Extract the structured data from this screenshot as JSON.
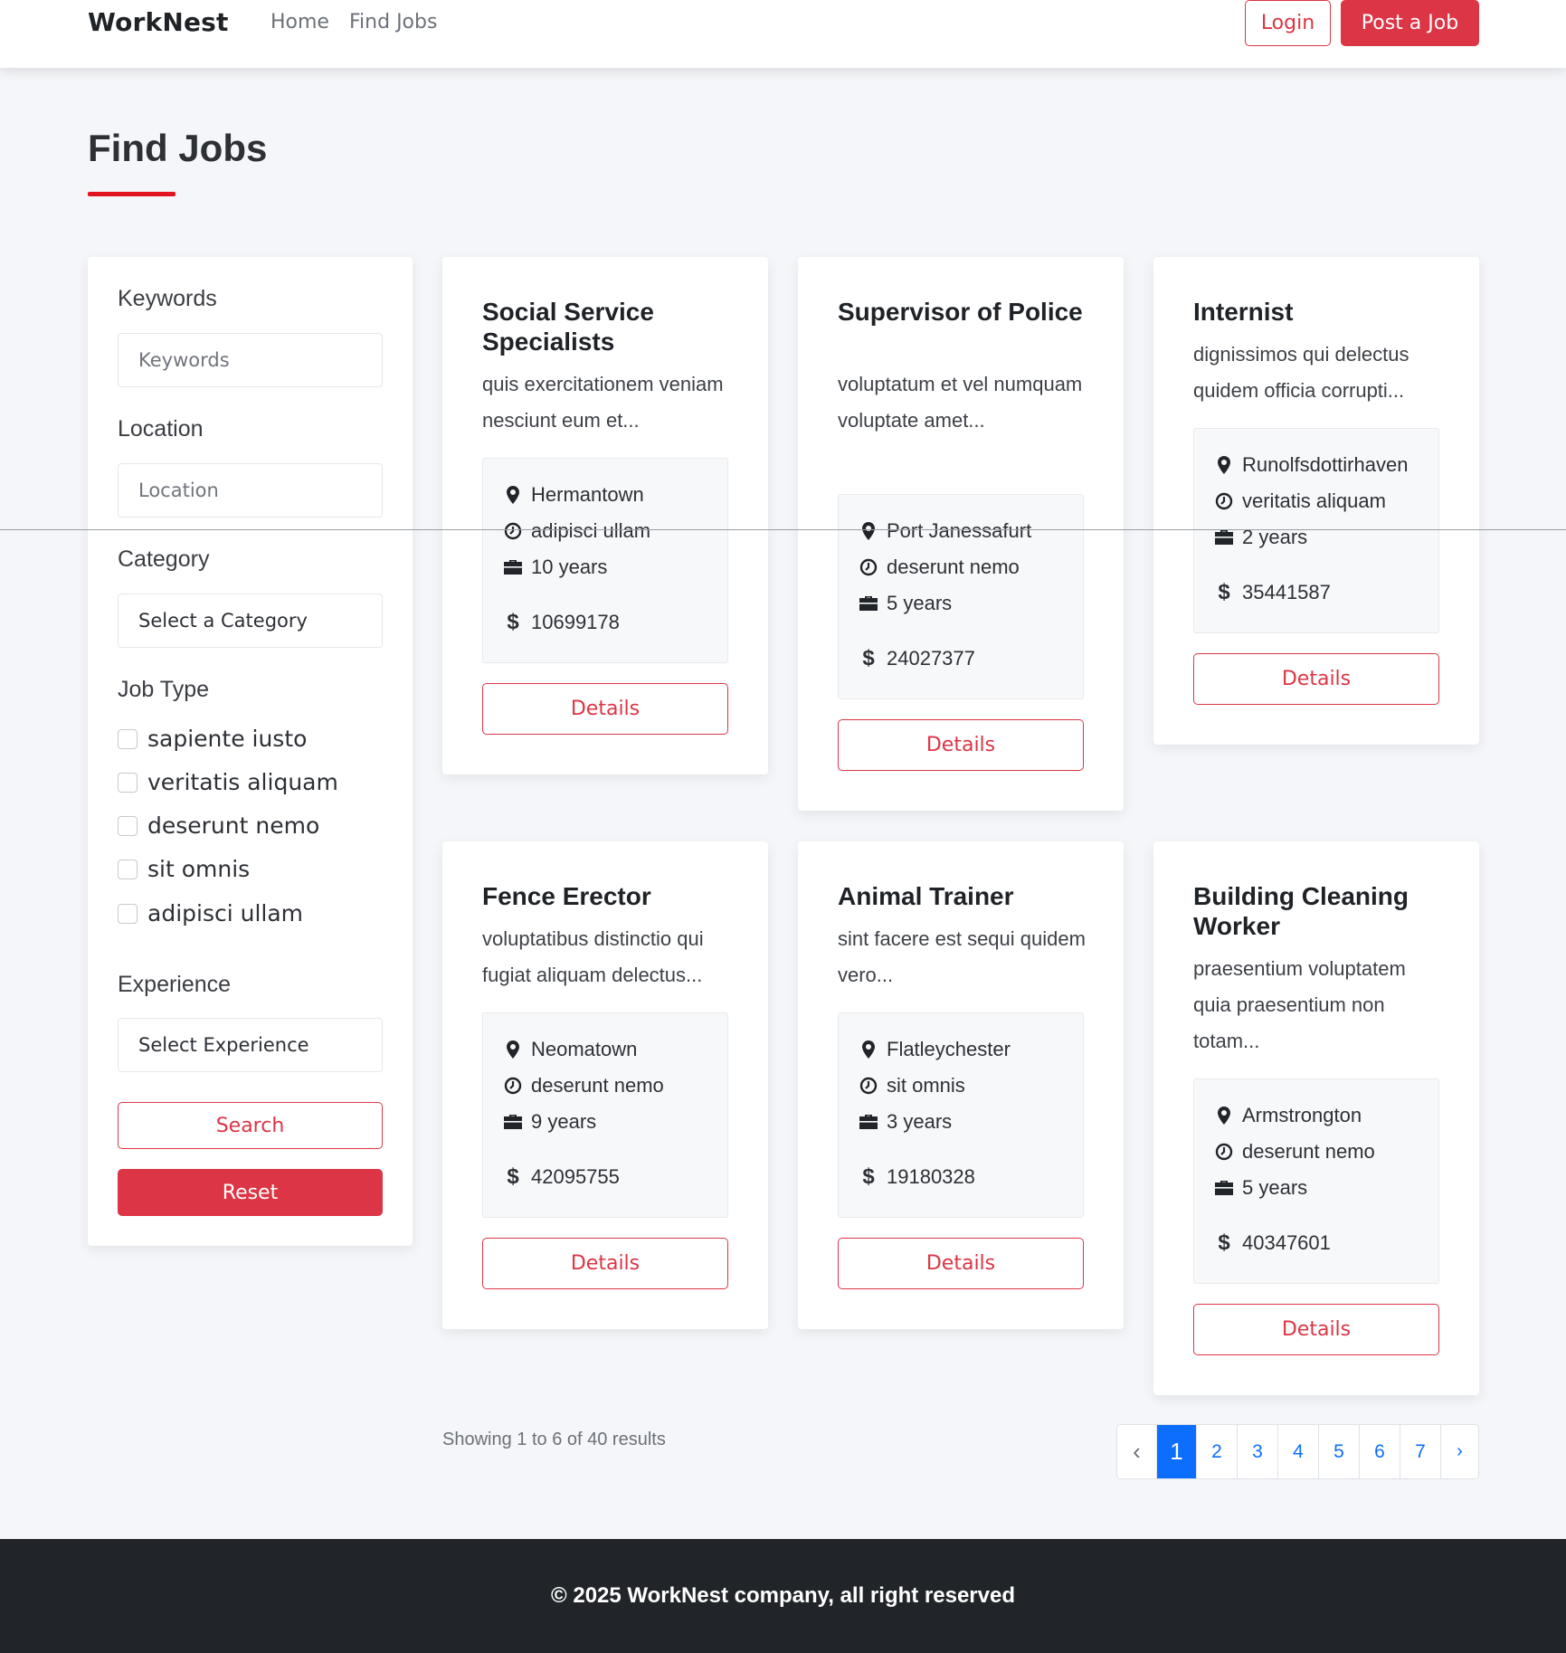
{
  "header": {
    "brand": "WorkNest",
    "nav": {
      "home": "Home",
      "find_jobs": "Find Jobs"
    },
    "login_label": "Login",
    "post_job_label": "Post a Job"
  },
  "page": {
    "title": "Find Jobs"
  },
  "filters": {
    "keywords_label": "Keywords",
    "keywords_placeholder": "Keywords",
    "location_label": "Location",
    "location_placeholder": "Location",
    "category_label": "Category",
    "category_selected": "Select a Category",
    "job_type_label": "Job Type",
    "job_types": [
      "sapiente iusto",
      "veritatis aliquam",
      "deserunt nemo",
      "sit omnis",
      "adipisci ullam"
    ],
    "experience_label": "Experience",
    "experience_selected": "Select Experience",
    "search_label": "Search",
    "reset_label": "Reset"
  },
  "jobs": [
    {
      "title": "Social Service Specialists",
      "description": "quis exercitationem veniam nesciunt eum et...",
      "location": "Hermantown",
      "job_type": "adipisci ullam",
      "experience": "10 years",
      "salary": "10699178",
      "details_label": "Details"
    },
    {
      "title": "Supervisor of Police",
      "description": "voluptatum et vel numquam voluptate amet...",
      "location": "Port Janessafurt",
      "job_type": "deserunt nemo",
      "experience": "5 years",
      "salary": "24027377",
      "details_label": "Details"
    },
    {
      "title": "Internist",
      "description": "dignissimos qui delectus quidem officia corrupti...",
      "location": "Runolfsdottirhaven",
      "job_type": "veritatis aliquam",
      "experience": "2 years",
      "salary": "35441587",
      "details_label": "Details"
    },
    {
      "title": "Fence Erector",
      "description": "voluptatibus distinctio qui fugiat aliquam delectus...",
      "location": "Neomatown",
      "job_type": "deserunt nemo",
      "experience": "9 years",
      "salary": "42095755",
      "details_label": "Details"
    },
    {
      "title": "Animal Trainer",
      "description": "sint facere est sequi quidem vero...",
      "location": "Flatleychester",
      "job_type": "sit omnis",
      "experience": "3 years",
      "salary": "19180328",
      "details_label": "Details"
    },
    {
      "title": "Building Cleaning Worker",
      "description": "praesentium voluptatem quia praesentium non totam...",
      "location": "Armstrongton",
      "job_type": "deserunt nemo",
      "experience": "5 years",
      "salary": "40347601",
      "details_label": "Details"
    }
  ],
  "pagination": {
    "summary": "Showing 1 to 6 of 40 results",
    "prev": "‹",
    "pages": [
      "1",
      "2",
      "3",
      "4",
      "5",
      "6",
      "7"
    ],
    "active_page": "1",
    "next": "›"
  },
  "footer": {
    "text": "© 2025 WorkNest company, all right reserved"
  },
  "colors": {
    "accent": "#dc3545",
    "page_active": "#0d6efd",
    "footer_bg": "#212529"
  },
  "icons": {
    "location": "map-pin-icon",
    "job_type": "clock-icon",
    "experience": "briefcase-icon",
    "salary": "dollar-icon"
  }
}
